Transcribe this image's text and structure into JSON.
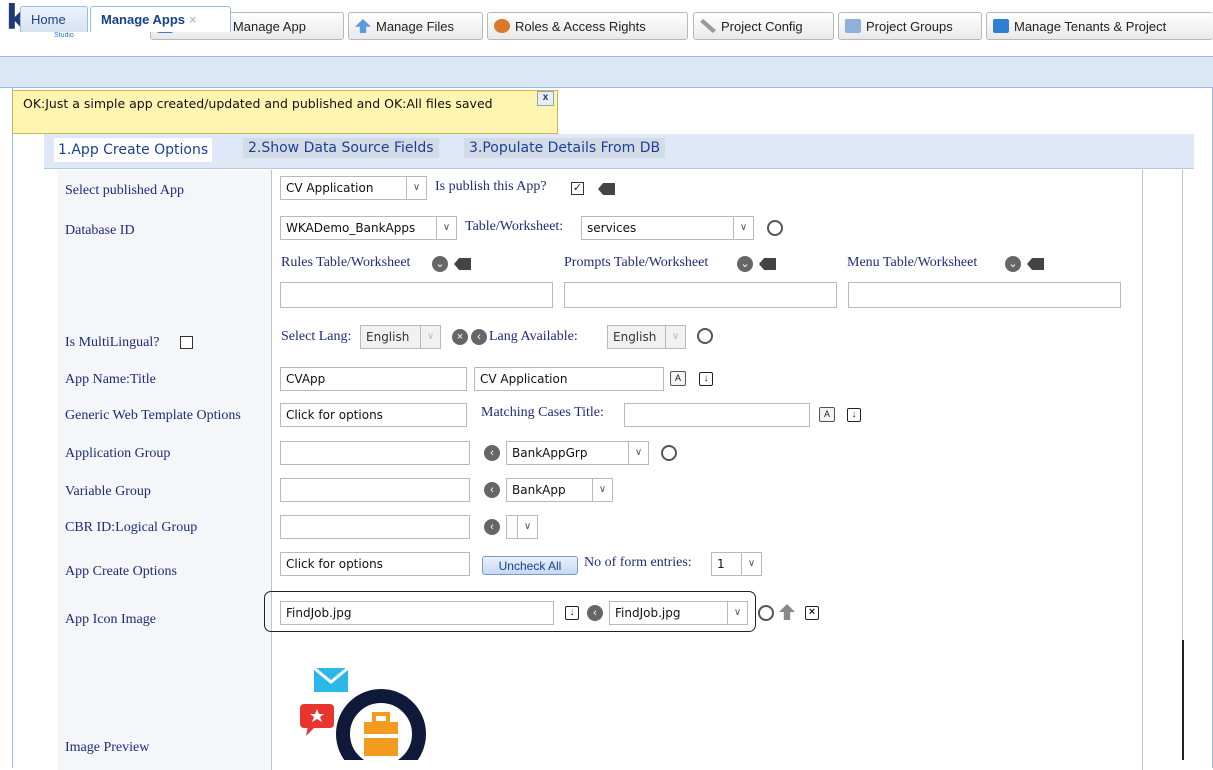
{
  "logo": {
    "text": "ka",
    "sub": "Studio"
  },
  "toolbar": {
    "buttons": [
      {
        "label": "Create & Manage App"
      },
      {
        "label": "Manage Files"
      },
      {
        "label": "Roles & Access Rights"
      },
      {
        "label": "Project Config"
      },
      {
        "label": "Project Groups"
      },
      {
        "label": "Manage Tenants & Project"
      }
    ]
  },
  "tabs": {
    "home": "Home",
    "manage_apps": "Manage Apps",
    "close": "×"
  },
  "notification": {
    "message": "OK:Just a simple app created/updated and published and OK:All files saved",
    "close": "x"
  },
  "wizard": {
    "steps": [
      "1.App Create Options",
      "2.Show Data Source Fields",
      "3.Populate Details From DB"
    ]
  },
  "form": {
    "select_published_app": {
      "label": "Select published App",
      "value": "CV Application",
      "publish_label": "Is publish this App?"
    },
    "database_id": {
      "label": "Database ID",
      "value": "WKADemo_BankApps",
      "table_label": "Table/Worksheet:",
      "table_value": "services"
    },
    "worksheets": {
      "rules": "Rules Table/Worksheet",
      "prompts": "Prompts Table/Worksheet",
      "menu": "Menu Table/Worksheet"
    },
    "multilingual": {
      "label": "Is MultiLingual?",
      "select_lang_label": "Select Lang:",
      "select_lang_value": "English",
      "lang_available_label": "Lang Available:",
      "lang_available_value": "English"
    },
    "app_name": {
      "label": "App Name:Title",
      "name": "CVApp",
      "title": "CV Application"
    },
    "web_template": {
      "label": "Generic Web Template Options",
      "value": "Click for options",
      "matching_label": "Matching Cases Title:"
    },
    "app_group": {
      "label": "Application Group",
      "value": "BankAppGrp"
    },
    "variable_group": {
      "label": "Variable Group",
      "value": "BankApp"
    },
    "cbr": {
      "label": "CBR ID:Logical Group"
    },
    "create_options": {
      "label": "App Create Options",
      "value": "Click for options",
      "uncheck": "Uncheck All",
      "entries_label": "No of form entries:",
      "entries_value": "1"
    },
    "icon_image": {
      "label": "App Icon Image",
      "file": "FindJob.jpg",
      "select": "FindJob.jpg"
    },
    "preview": {
      "label": "Image Preview"
    }
  },
  "colors": {
    "label": "#1f2a7a",
    "tab_border": "#99bbe8",
    "notify_bg": "#fff4b0",
    "wizard_bg": "#dfe8f6"
  }
}
